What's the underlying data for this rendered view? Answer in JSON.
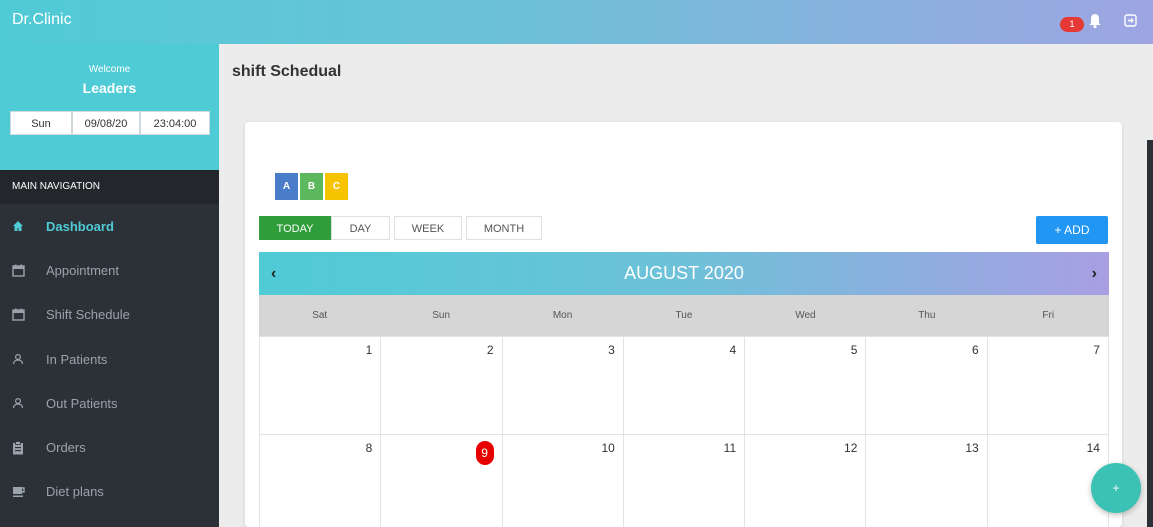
{
  "app": {
    "brand": "Dr.Clinic",
    "notification_count": "1"
  },
  "user": {
    "welcome": "Welcome",
    "name": "Leaders"
  },
  "clock": {
    "day": "Sun",
    "date": "09/08/20",
    "time": "23:04:00"
  },
  "nav": {
    "header": "MAIN NAVIGATION",
    "items": [
      {
        "label": "Dashboard",
        "icon": "home-icon",
        "active": true
      },
      {
        "label": "Appointment",
        "icon": "calendar-icon"
      },
      {
        "label": "Shift Schedule",
        "icon": "calendar-icon"
      },
      {
        "label": "In Patients",
        "icon": "user-icon"
      },
      {
        "label": "Out Patients",
        "icon": "user-icon"
      },
      {
        "label": "Orders",
        "icon": "clipboard-icon"
      },
      {
        "label": "Diet plans",
        "icon": "cup-icon"
      }
    ]
  },
  "page": {
    "title": "shift Schedual"
  },
  "shifts": [
    {
      "label": "A",
      "color": "#4a7dc9"
    },
    {
      "label": "B",
      "color": "#5cb85c"
    },
    {
      "label": "C",
      "color": "#f5c300"
    }
  ],
  "views": {
    "today": "TODAY",
    "day": "DAY",
    "week": "WEEK",
    "month": "MONTH"
  },
  "add_label": "+ ADD",
  "calendar": {
    "month_label": "AUGUST 2020",
    "prev": "‹",
    "next": "›",
    "weekdays": [
      "Sat",
      "Sun",
      "Mon",
      "Tue",
      "Wed",
      "Thu",
      "Fri"
    ],
    "weeks": [
      [
        "1",
        "2",
        "3",
        "4",
        "5",
        "6",
        "7"
      ],
      [
        "8",
        "9",
        "10",
        "11",
        "12",
        "13",
        "14"
      ]
    ],
    "today": "9"
  },
  "fab_label": "+"
}
